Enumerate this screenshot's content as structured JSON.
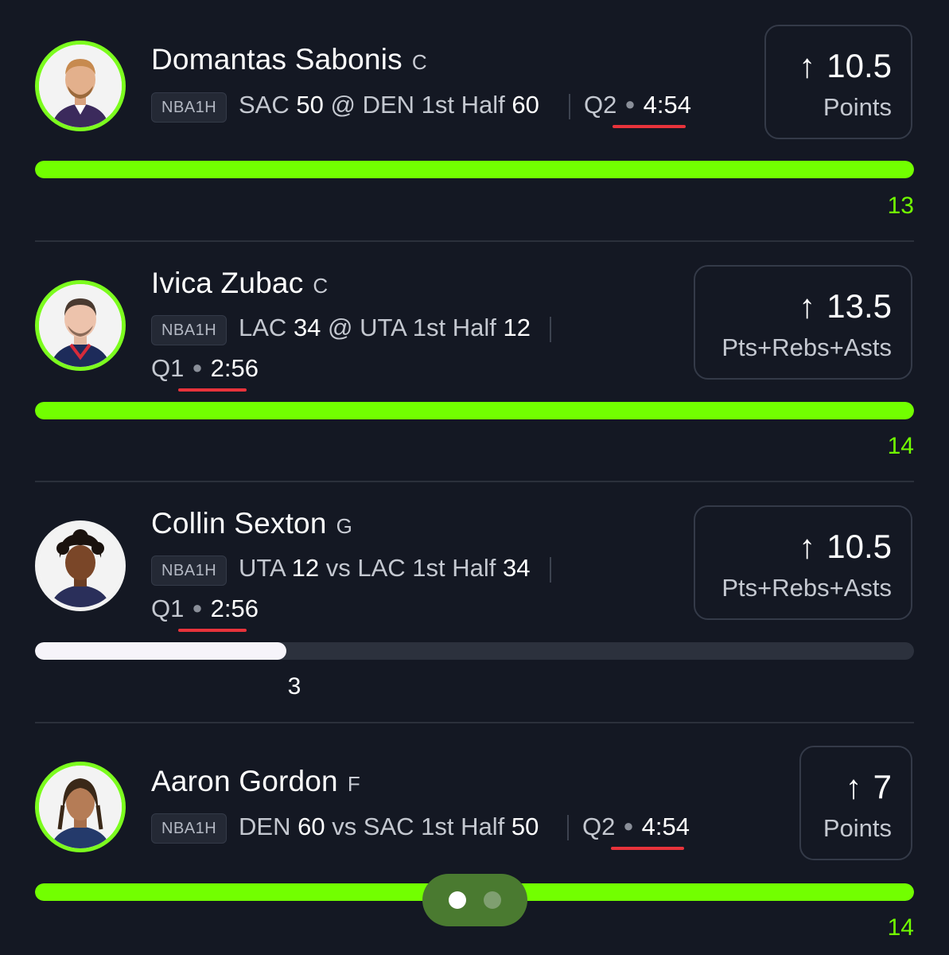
{
  "players": [
    {
      "name": "Domantas Sabonis",
      "position": "C",
      "league": "NBA1H",
      "game_prefix": "SAC",
      "score_a": "50",
      "game_mid": "@ DEN 1st Half",
      "score_b": "60",
      "quarter": "Q2",
      "time": "4:54",
      "line_value": "10.5",
      "stat": "Points",
      "current": "13",
      "progress_fraction": 1.0,
      "bar_color": "#72FF00"
    },
    {
      "name": "Ivica Zubac",
      "position": "C",
      "league": "NBA1H",
      "game_prefix": "LAC",
      "score_a": "34",
      "game_mid": "@ UTA 1st Half",
      "score_b": "12",
      "quarter": "Q1",
      "time": "2:56",
      "line_value": "13.5",
      "stat": "Pts+Rebs+Asts",
      "current": "14",
      "progress_fraction": 1.0,
      "bar_color": "#72FF00"
    },
    {
      "name": "Collin Sexton",
      "position": "G",
      "league": "NBA1H",
      "game_prefix": "UTA",
      "score_a": "12",
      "game_mid": "vs LAC 1st Half",
      "score_b": "34",
      "quarter": "Q1",
      "time": "2:56",
      "line_value": "10.5",
      "stat": "Pts+Rebs+Asts",
      "current": "3",
      "progress_fraction": 0.286,
      "bar_color": "#F6F4FA"
    },
    {
      "name": "Aaron Gordon",
      "position": "F",
      "league": "NBA1H",
      "game_prefix": "DEN",
      "score_a": "60",
      "game_mid": "vs SAC 1st Half",
      "score_b": "50",
      "quarter": "Q2",
      "time": "4:54",
      "line_value": "7",
      "stat": "Points",
      "current": "14",
      "progress_fraction": 1.0,
      "bar_color": "#72FF00"
    }
  ],
  "arrow_icon": "arrow-up-icon",
  "pager": {
    "pages": 2,
    "active": 0
  },
  "colors": {
    "accent": "#72FF00",
    "background": "#141823",
    "underline": "#E8333B"
  }
}
